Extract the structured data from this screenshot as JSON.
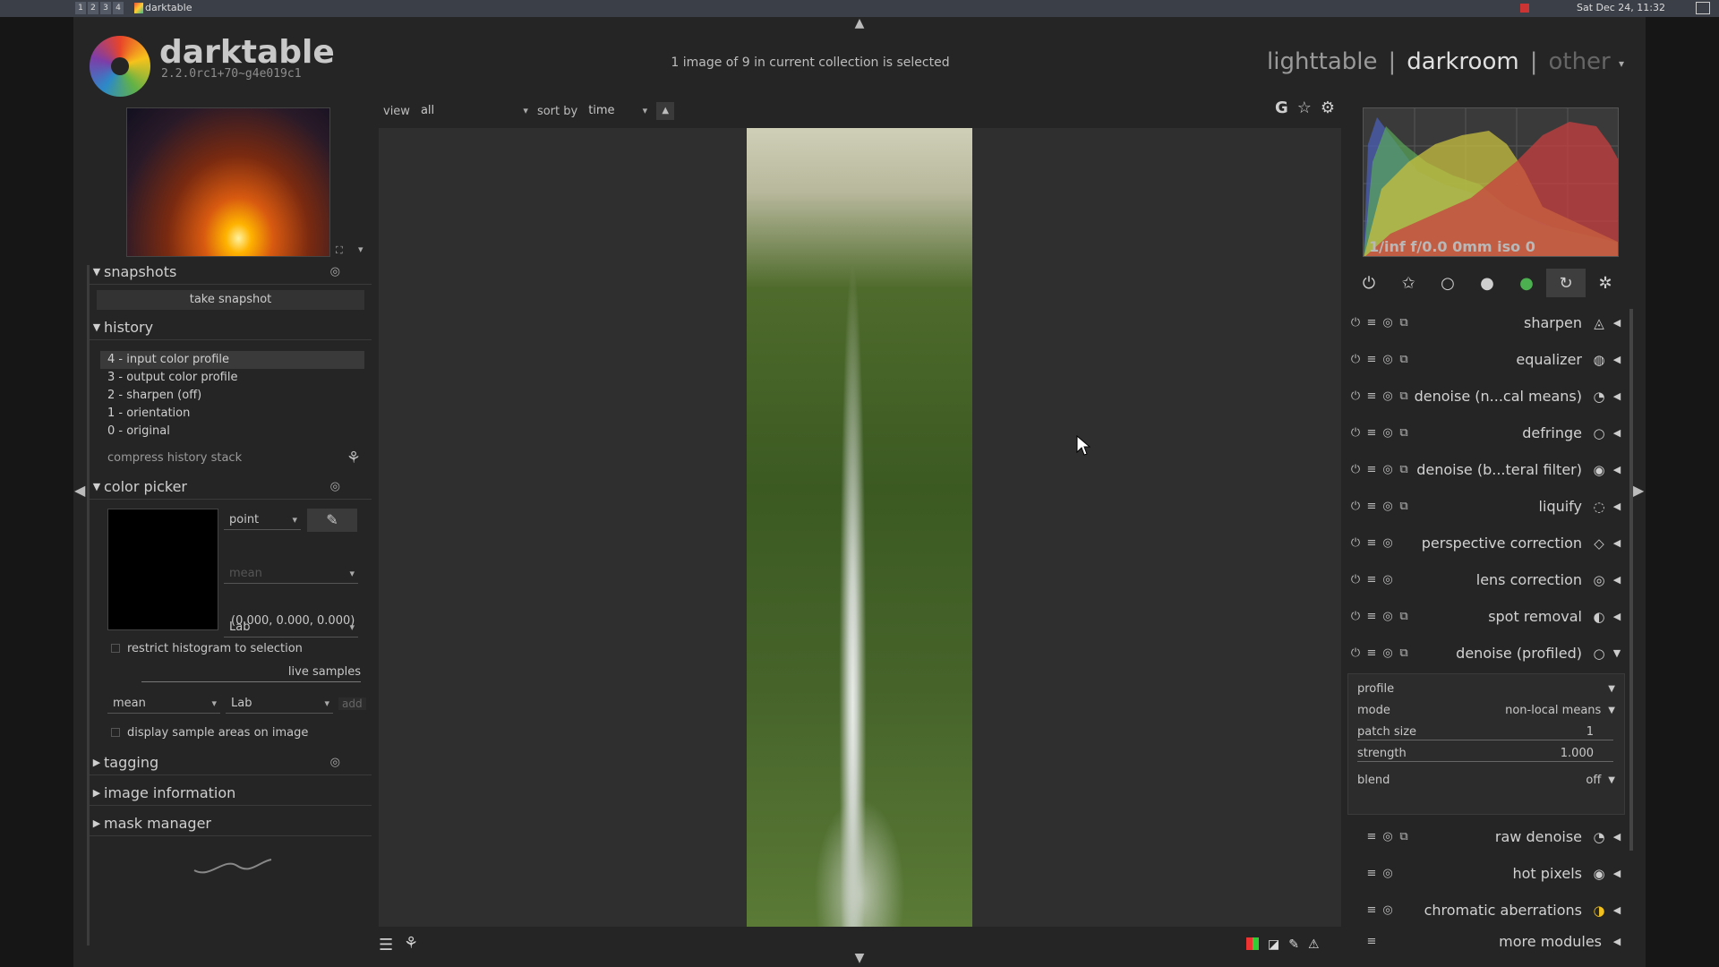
{
  "system_bar": {
    "app_name": "darktable",
    "workspaces": [
      "1",
      "2",
      "3",
      "4"
    ],
    "clock": "Sat Dec 24, 11:32"
  },
  "logo": {
    "name": "darktable",
    "version": "2.2.0rc1+70~g4e019c1"
  },
  "header": {
    "collection_info": "1 image of 9 in current collection is selected",
    "views": [
      "lighttable",
      "darkroom",
      "other"
    ],
    "separator": "|",
    "active_view": "darkroom"
  },
  "toolbar": {
    "view_label": "view",
    "view_value": "all",
    "sort_label": "sort by",
    "sort_value": "time",
    "sort_dir_icon": "triangle-up-icon",
    "global_icons": [
      "G",
      "☆",
      "⚙"
    ]
  },
  "histogram": {
    "exif": "1/inf f/0.0 0mm iso 0"
  },
  "snapshots": {
    "title": "snapshots",
    "button": "take snapshot"
  },
  "history": {
    "title": "history",
    "items": [
      "4 - input color profile",
      "3 - output color profile",
      "2 - sharpen (off)",
      "1 - orientation",
      "0 - original"
    ],
    "selected_index": 0,
    "compress_label": "compress history stack"
  },
  "color_picker": {
    "title": "color picker",
    "mode": "point",
    "stat": "mean",
    "colorspace": "Lab",
    "values": "(0.000, 0.000, 0.000)",
    "restrict_label": "restrict histogram to selection",
    "live_samples_label": "live samples",
    "sample_stat": "mean",
    "sample_colorspace": "Lab",
    "add_label": "add",
    "display_areas_label": "display sample areas on image"
  },
  "left_collapsed": {
    "tagging": "tagging",
    "image_information": "image information",
    "mask_manager": "mask manager"
  },
  "module_groups": [
    "power-icon",
    "star-icon",
    "circle-icon",
    "tone-icon",
    "color-icon",
    "correct-icon",
    "effect-icon"
  ],
  "modules": [
    {
      "name": "sharpen",
      "icon": "◬"
    },
    {
      "name": "equalizer",
      "icon": "◍"
    },
    {
      "name": "denoise (n...cal means)",
      "icon": "◔"
    },
    {
      "name": "defringe",
      "icon": "○"
    },
    {
      "name": "denoise (b...teral filter)",
      "icon": "◉"
    },
    {
      "name": "liquify",
      "icon": "◌"
    },
    {
      "name": "perspective correction",
      "icon": "◇"
    },
    {
      "name": "lens correction",
      "icon": "◎"
    },
    {
      "name": "spot removal",
      "icon": "◐"
    },
    {
      "name": "denoise (profiled)",
      "icon": "○"
    }
  ],
  "denoise_params": {
    "profile_label": "profile",
    "mode_label": "mode",
    "mode_value": "non-local means",
    "patch_label": "patch size",
    "patch_value": "1",
    "strength_label": "strength",
    "strength_value": "1.000",
    "blend_label": "blend",
    "blend_value": "off"
  },
  "modules_bottom": [
    {
      "name": "raw denoise",
      "icon": "◔"
    },
    {
      "name": "hot pixels",
      "icon": "◉"
    },
    {
      "name": "chromatic aberrations",
      "icon": "◑"
    }
  ],
  "more_modules": "more modules",
  "colors": {
    "panel_bg": "#252525",
    "center_bg": "#2f2f2f",
    "accent": "#d8d8d8"
  }
}
